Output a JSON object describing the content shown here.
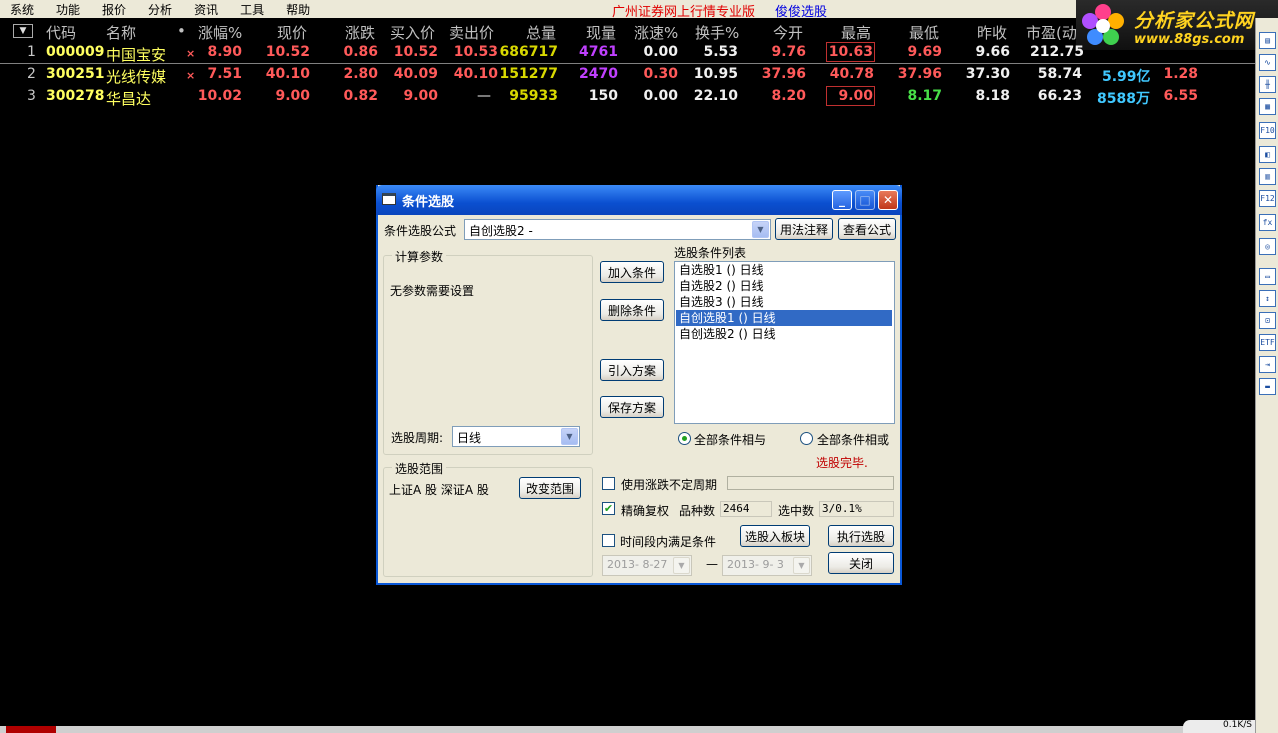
{
  "menu": {
    "items": [
      "系统",
      "功能",
      "报价",
      "分析",
      "资讯",
      "工具",
      "帮助"
    ]
  },
  "app": {
    "title": "广州证券网上行情专业版",
    "subtitle": "俊俊选股"
  },
  "logo": {
    "line1": "分析家公式网",
    "line2": "www.88gs.com"
  },
  "table": {
    "sort_icon": "▼",
    "headers": [
      "代码",
      "名称",
      "•",
      "涨幅%",
      "现价",
      "涨跌",
      "买入价",
      "卖出价",
      "总量",
      "现量",
      "涨速%",
      "换手%",
      "今开",
      "最高",
      "最低",
      "昨收",
      "市盈(动"
    ],
    "rows": [
      {
        "idx": "1",
        "code": "000009",
        "name": "中国宝安",
        "flag": "×",
        "chg_pct": "8.90",
        "price": "10.52",
        "chg": "0.86",
        "bid": "10.52",
        "ask": "10.53",
        "vol": "686717",
        "cur_vol": "4761",
        "speed": "0.00",
        "turnover": "5.53",
        "open": "9.76",
        "high": "10.63",
        "low": "9.69",
        "prev": "9.66",
        "pe": "212.75",
        "cap": "",
        "last": ""
      },
      {
        "idx": "2",
        "code": "300251",
        "name": "光线传媒",
        "flag": "×",
        "chg_pct": "7.51",
        "price": "40.10",
        "chg": "2.80",
        "bid": "40.09",
        "ask": "40.10",
        "vol": "151277",
        "cur_vol": "2470",
        "speed": "0.30",
        "turnover": "10.95",
        "open": "37.96",
        "high": "40.78",
        "low": "37.96",
        "prev": "37.30",
        "pe": "58.74",
        "cap": "5.99亿",
        "last": "1.28"
      },
      {
        "idx": "3",
        "code": "300278",
        "name": "华昌达",
        "flag": "",
        "chg_pct": "10.02",
        "price": "9.00",
        "chg": "0.82",
        "bid": "9.00",
        "ask": "—",
        "vol": "95933",
        "cur_vol": "150",
        "speed": "0.00",
        "turnover": "22.10",
        "open": "8.20",
        "high": "9.00",
        "low": "8.17",
        "prev": "8.18",
        "pe": "66.23",
        "cap": "8588万",
        "last": "6.55"
      }
    ]
  },
  "dialog": {
    "title": "条件选股",
    "formula_label": "条件选股公式",
    "formula_value": "自创选股2 -",
    "usage_button": "用法注释",
    "view_formula_button": "查看公式",
    "params_group": "计算参数",
    "params_text": "无参数需要设置",
    "period_label": "选股周期:",
    "period_value": "日线",
    "add_button": "加入条件",
    "delete_button": "删除条件",
    "import_button": "引入方案",
    "save_button": "保存方案",
    "list_label": "选股条件列表",
    "conditions": [
      "自选股1  () 日线",
      "自选股2  () 日线",
      "自选股3  () 日线",
      "自创选股1  () 日线",
      "自创选股2  () 日线"
    ],
    "selected_index": 3,
    "radio_and": "全部条件相与",
    "radio_or": "全部条件相或",
    "status": "选股完毕.",
    "range_group": "选股范围",
    "range_text": "上证A 股 深证A 股",
    "change_range_button": "改变范围",
    "use_period_label": "使用涨跌不定周期",
    "precise_label": "精确复权",
    "count_label": "品种数",
    "count_value": "2464",
    "selected_label": "选中数",
    "selected_value": "3/0.1%",
    "time_label": "时间段内满足条件",
    "to_block_button": "选股入板块",
    "execute_button": "执行选股",
    "close_button": "关闭",
    "date_from": "2013- 8-27",
    "date_sep": "—",
    "date_to": "2013- 9- 3"
  },
  "rtool_icons": [
    "list-icon",
    "line-chart-icon",
    "kline-icon",
    "table-icon",
    "f10-icon",
    "news-icon",
    "book-icon",
    "f12-icon",
    "formula-icon",
    "search-icon",
    "folder-icon",
    "updown-icon",
    "target-icon",
    "etf-icon",
    "export-icon",
    "print-icon"
  ],
  "rtool_labels": [
    "▤",
    "∿",
    "╫",
    "▦",
    "F10",
    "◧",
    "▥",
    "F12",
    "fx",
    "◎",
    "▭",
    "↕",
    "⊡",
    "ETF",
    "⇥",
    "▬"
  ],
  "netspeed": "0.1K/S",
  "colors": {
    "up": "#ff5a5a",
    "down": "#48e048",
    "title_bar": "#0a4fd0",
    "selection": "#316ac5",
    "status": "#c00000"
  }
}
